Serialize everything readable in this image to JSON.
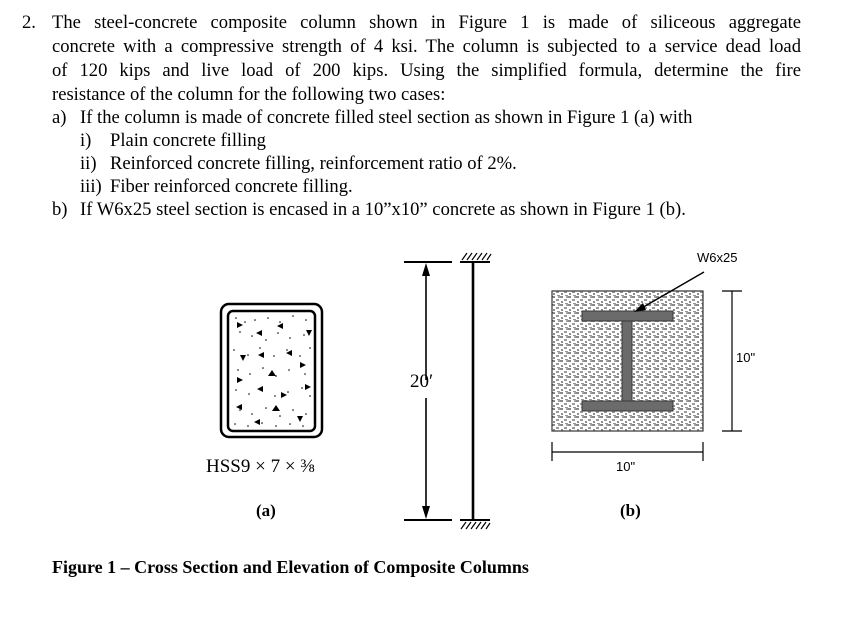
{
  "problem": {
    "number": "2.",
    "lines": [
      "The steel-concrete composite column shown in Figure 1 is made of siliceous aggregate",
      "concrete with a compressive strength of 4 ksi. The column is subjected to a service dead load",
      "of 120 kips and live load of 200 kips. Using the simplified formula, determine the fire",
      "resistance of the column for the following two cases:"
    ],
    "parts": [
      {
        "marker": "a)",
        "text": "If the column is made of concrete filled steel section as shown in Figure 1 (a) with"
      },
      {
        "marker": "i)",
        "text": "Plain concrete filling"
      },
      {
        "marker": "ii)",
        "text": "Reinforced concrete filling, reinforcement ratio of 2%."
      },
      {
        "marker": "iii)",
        "text": "Fiber reinforced concrete filling."
      },
      {
        "marker": "b)",
        "text": "If W6x25 steel section is encased in a 10”x10” concrete as shown in Figure 1 (b)."
      }
    ]
  },
  "figure": {
    "a_section_label": "HSS9 × 7 × ⅜",
    "a_label": "(a)",
    "column_length": "20′",
    "b_section_label": "W6x25",
    "b_height": "10\"",
    "b_width": "10\"",
    "b_label": "(b)",
    "caption": "Figure 1 – Cross Section and Elevation of Composite Columns"
  }
}
